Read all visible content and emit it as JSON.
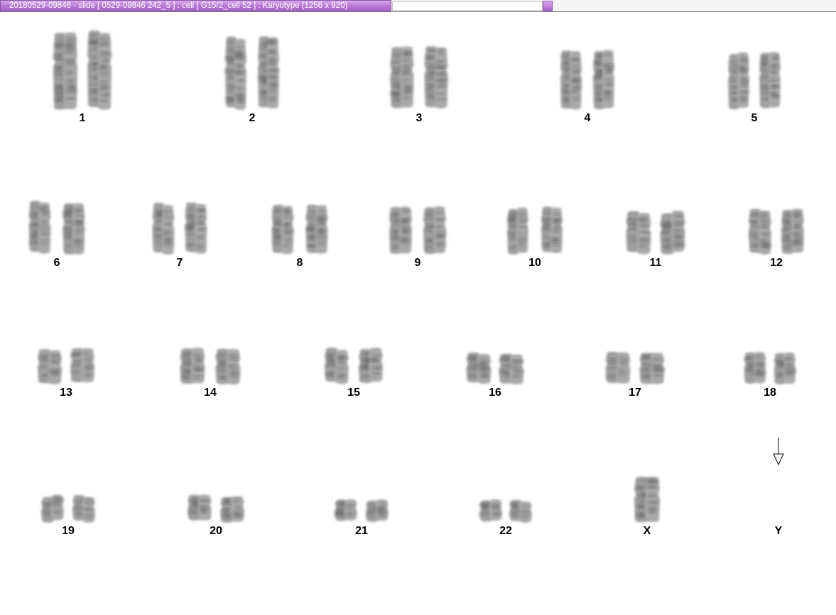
{
  "window": {
    "title": "20180529-09846 - slide [ 0529-09846 242_5 ] : cell [ G15/2_cell 52 ] : Karyotype  (1256 x 920)"
  },
  "karyotype": {
    "chromosomes": [
      {
        "label": "1",
        "count": 2
      },
      {
        "label": "2",
        "count": 2
      },
      {
        "label": "3",
        "count": 2
      },
      {
        "label": "4",
        "count": 2
      },
      {
        "label": "5",
        "count": 2
      },
      {
        "label": "6",
        "count": 2
      },
      {
        "label": "7",
        "count": 2
      },
      {
        "label": "8",
        "count": 2
      },
      {
        "label": "9",
        "count": 2
      },
      {
        "label": "10",
        "count": 2
      },
      {
        "label": "11",
        "count": 2
      },
      {
        "label": "12",
        "count": 2
      },
      {
        "label": "13",
        "count": 2
      },
      {
        "label": "14",
        "count": 2
      },
      {
        "label": "15",
        "count": 2
      },
      {
        "label": "16",
        "count": 2
      },
      {
        "label": "17",
        "count": 2
      },
      {
        "label": "18",
        "count": 2
      },
      {
        "label": "19",
        "count": 2
      },
      {
        "label": "20",
        "count": 2
      },
      {
        "label": "21",
        "count": 2
      },
      {
        "label": "22",
        "count": 2
      },
      {
        "label": "X",
        "count": 1
      },
      {
        "label": "Y",
        "count": 0
      }
    ]
  }
}
